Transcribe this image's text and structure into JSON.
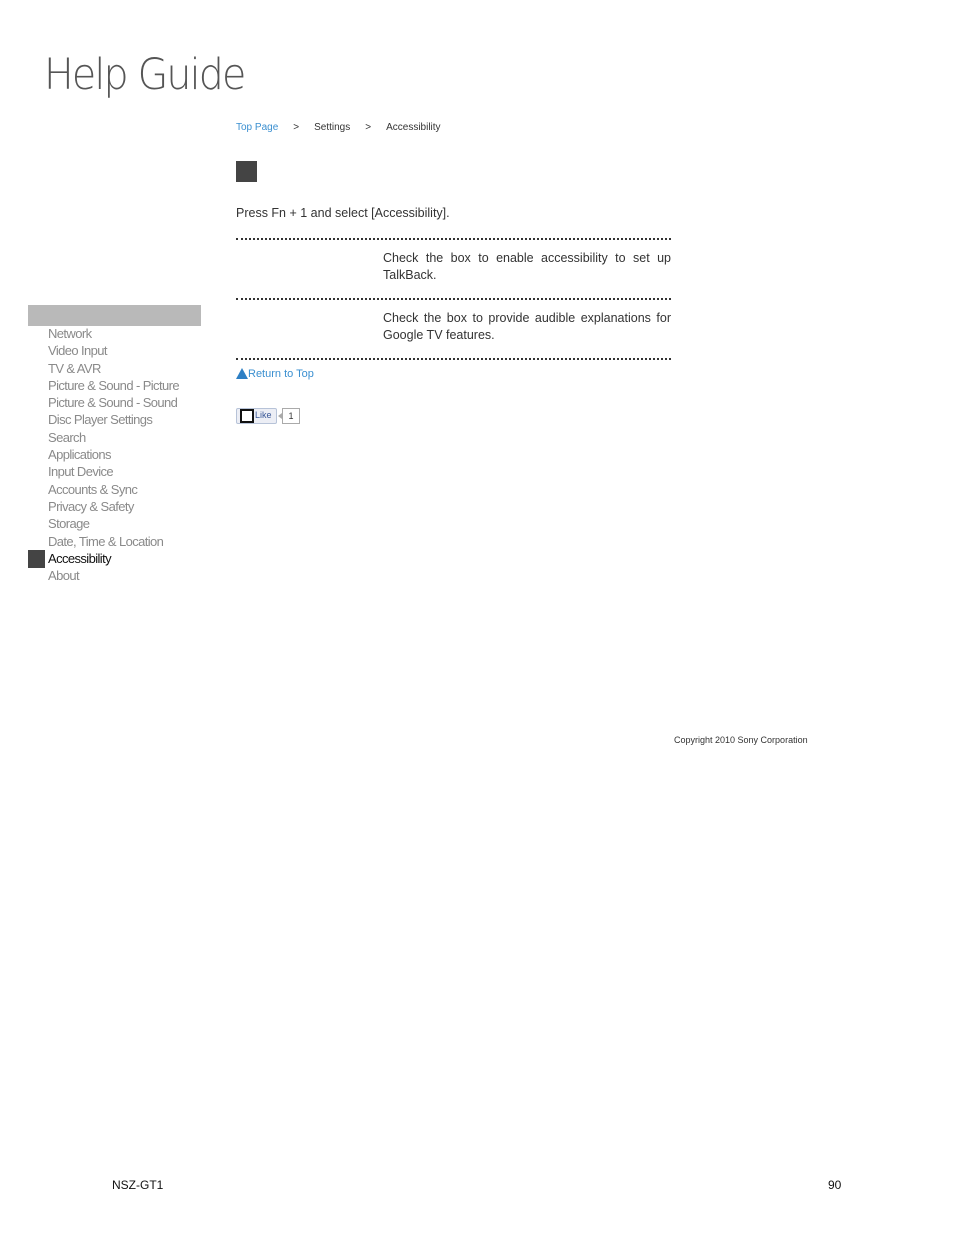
{
  "header": {
    "logo_text": "Help Guide"
  },
  "sidebar": {
    "items": [
      {
        "label": "Network",
        "active": false
      },
      {
        "label": "Video Input",
        "active": false
      },
      {
        "label": "TV & AVR",
        "active": false
      },
      {
        "label": "Picture & Sound - Picture",
        "active": false
      },
      {
        "label": "Picture & Sound - Sound",
        "active": false
      },
      {
        "label": "Disc Player Settings",
        "active": false
      },
      {
        "label": "Search",
        "active": false
      },
      {
        "label": "Applications",
        "active": false
      },
      {
        "label": "Input Device",
        "active": false
      },
      {
        "label": "Accounts & Sync",
        "active": false
      },
      {
        "label": "Privacy & Safety",
        "active": false
      },
      {
        "label": "Storage",
        "active": false
      },
      {
        "label": "Date, Time & Location",
        "active": false
      },
      {
        "label": "Accessibility",
        "active": true
      },
      {
        "label": "About",
        "active": false
      }
    ]
  },
  "breadcrumb": {
    "top_page": "Top Page",
    "separator": ">",
    "settings": "Settings",
    "current": "Accessibility"
  },
  "main": {
    "intro": "Press Fn + 1 and select [Accessibility].",
    "rows": [
      {
        "description": "Check the box to enable accessibility to set up TalkBack."
      },
      {
        "description": "Check the box to provide audible explanations for Google TV features."
      }
    ],
    "return_top": "Return to Top",
    "like": {
      "label": "Like",
      "count": "1"
    }
  },
  "footer": {
    "copyright": "Copyright 2010 Sony Corporation",
    "model": "NSZ-GT1",
    "page_number": "90"
  },
  "colors": {
    "link": "#3a8fd0",
    "sidebar_header": "#b9b9b9",
    "marker": "#444444"
  }
}
